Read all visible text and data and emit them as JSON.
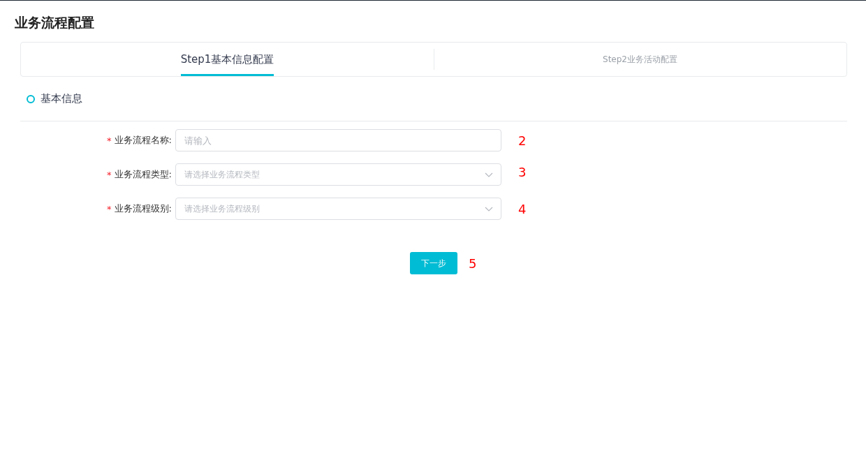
{
  "page": {
    "title": "业务流程配置"
  },
  "steps": [
    {
      "label": "Step1基本信息配置",
      "selected": true
    },
    {
      "label": "Step2业务活动配置",
      "selected": false
    }
  ],
  "section": {
    "title": "基本信息"
  },
  "fields": [
    {
      "kind": "input",
      "label": "业务流程名称:",
      "required_mark": "*",
      "placeholder": "请输入",
      "annotation": "2"
    },
    {
      "kind": "select",
      "label": "业务流程类型:",
      "required_mark": "*",
      "placeholder": "请选择业务流程类型",
      "annotation": "3"
    },
    {
      "kind": "select",
      "label": "业务流程级别:",
      "required_mark": "*",
      "placeholder": "请选择业务流程级别",
      "annotation": "4"
    }
  ],
  "next_button": {
    "label": "下一步",
    "annotation": "5"
  }
}
